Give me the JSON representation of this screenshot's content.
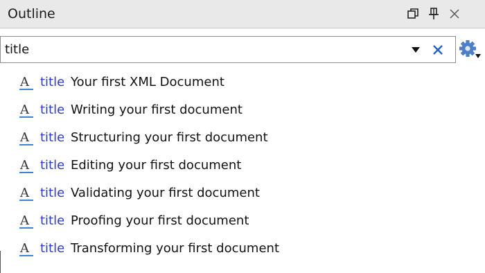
{
  "panel": {
    "title": "Outline",
    "controls": {
      "restore_icon": "restore-window-icon",
      "pin_icon": "pin-icon",
      "close_icon": "close-icon"
    }
  },
  "filter": {
    "value": "title",
    "dropdown_icon": "dropdown-arrow-icon",
    "clear_icon": "clear-filter-icon",
    "settings_icon": "settings-gear-icon"
  },
  "outline": {
    "items": [
      {
        "tag": "title",
        "text": "Your first XML Document"
      },
      {
        "tag": "title",
        "text": "Writing your first document"
      },
      {
        "tag": "title",
        "text": "Structuring your first document"
      },
      {
        "tag": "title",
        "text": "Editing your first document"
      },
      {
        "tag": "title",
        "text": "Validating your first document"
      },
      {
        "tag": "title",
        "text": "Proofing your first document"
      },
      {
        "tag": "title",
        "text": "Transforming your first document"
      }
    ]
  },
  "colors": {
    "tag": "#2e3db8",
    "clear_x": "#2a5fc0",
    "underline": "#3f7fd6",
    "titlebar_bg": "#e9e9e9"
  }
}
